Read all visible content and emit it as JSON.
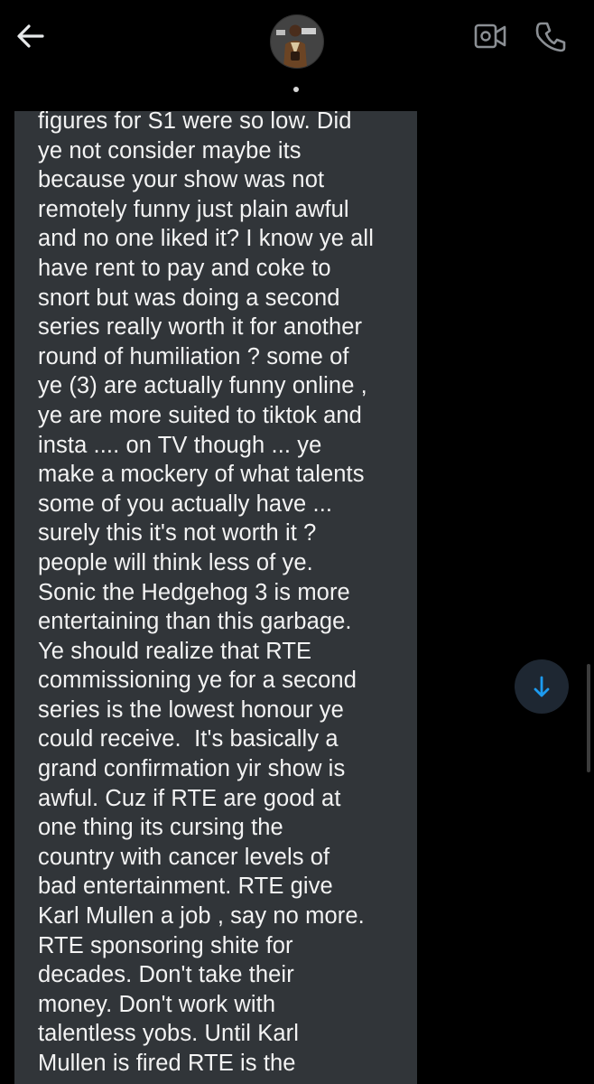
{
  "header": {
    "back_icon": "arrow-left-icon",
    "video_icon": "video-camera-icon",
    "call_icon": "phone-icon"
  },
  "message": {
    "text": "figures for S1 were so low. Did\nye not consider maybe its\nbecause your show was not\nremotely funny just plain awful\nand no one liked it? I know ye all\nhave rent to pay and coke to\nsnort but was doing a second\nseries really worth it for another\nround of humiliation ? some of\nye (3) are actually funny online ,\nye are more suited to tiktok and\ninsta .... on TV though ... ye\nmake a mockery of what talents\nsome of you actually have ...\nsurely this it's not worth it ?\npeople will think less of ye.\nSonic the Hedgehog 3 is more\nentertaining than this garbage.\nYe should realize that RTE\ncommissioning ye for a second\nseries is the lowest honour ye\ncould receive.  It's basically a\ngrand confirmation yir show is\nawful. Cuz if RTE are good at\none thing its cursing the\ncountry with cancer levels of\nbad entertainment. RTE give\nKarl Mullen a job , say no more.\nRTE sponsoring shite for\ndecades. Don't take their\nmoney. Don't work with\ntalentless yobs. Until Karl\nMullen is fired RTE is the"
  },
  "scroll_down_icon": "arrow-down-icon",
  "colors": {
    "background": "#000000",
    "bubble": "#313539",
    "text": "#f3f3f3",
    "accent": "#1d9bf0",
    "scroll_button": "#1e2732"
  }
}
